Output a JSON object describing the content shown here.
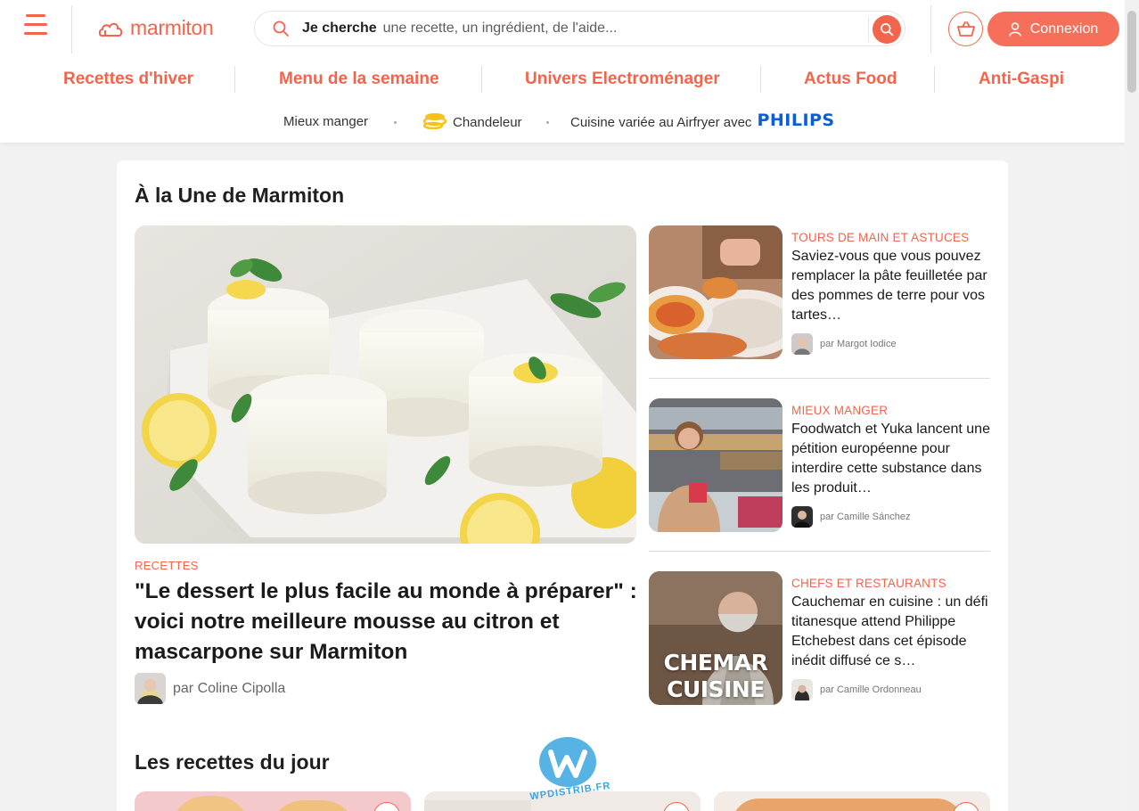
{
  "header": {
    "logo_text": "marmiton",
    "search": {
      "strong_label": "Je cherche",
      "placeholder": "une recette, un ingrédient, de l'aide..."
    },
    "login_label": "Connexion"
  },
  "main_nav": [
    "Recettes d'hiver",
    "Menu de la semaine",
    "Univers Electroménager",
    "Actus Food",
    "Anti-Gaspi"
  ],
  "sub_nav": {
    "item1": "Mieux manger",
    "item2": "Chandeleur",
    "item3": "Cuisine variée au Airfryer avec",
    "brand": "PHILIPS"
  },
  "une": {
    "section_title": "À la Une de Marmiton",
    "hero": {
      "category": "RECETTES",
      "title": "\"Le dessert le plus facile au monde à préparer\" : voici notre meilleure mousse au citron et mascarpone sur Marmiton",
      "author": "par Coline Cipolla"
    },
    "side_articles": [
      {
        "category": "TOURS DE MAIN ET ASTUCES",
        "title": "Saviez-vous que vous pouvez remplacer la pâte feuilletée par des pommes de terre pour vos tartes…",
        "author": "par Margot Iodice"
      },
      {
        "category": "MIEUX MANGER",
        "title": "Foodwatch et Yuka lancent une pétition européenne pour interdire cette substance dans les produit…",
        "author": "par Camille Sánchez"
      },
      {
        "category": "CHEFS ET RESTAURANTS",
        "title": "Cauchemar en cuisine : un défi titanesque attend Philippe Etchebest dans cet épisode inédit diffusé ce s…",
        "author": "par Camille Ordonneau"
      }
    ],
    "tv_image_text": "CHEMAR CUISINE"
  },
  "recettes_du_jour": {
    "section_title": "Les recettes du jour"
  },
  "watermark_text": "WPDISTRIB.FR",
  "colors": {
    "brand": "#f2644c",
    "philips": "#0b5ed7",
    "background": "#f2f2f2"
  }
}
